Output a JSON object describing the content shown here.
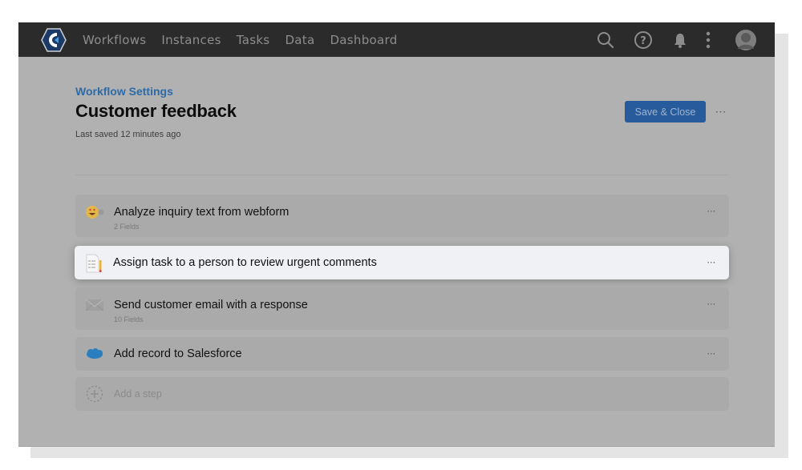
{
  "app": {
    "logo": "app-logo-hexagon",
    "nav": [
      "Workflows",
      "Instances",
      "Tasks",
      "Data",
      "Dashboard"
    ],
    "icons": [
      "search-icon",
      "help-icon",
      "bell-icon",
      "more-vertical-icon",
      "avatar"
    ]
  },
  "header": {
    "breadcrumb": "Workflow Settings",
    "title": "Customer feedback",
    "subtitle": "Last saved 12 minutes ago",
    "save_label": "Save & Close",
    "more_label": "⋯"
  },
  "steps": [
    {
      "title": "Analyze inquiry text from webform",
      "sub": "2 Fields",
      "icon": "emoji-sentiment-icon",
      "more": "⋯"
    },
    {
      "title": "Assign task to a person to review urgent comments",
      "sub": "",
      "icon": "form-task-icon",
      "more": "⋯",
      "active": true
    },
    {
      "title": "Send customer email with a response",
      "sub": "10 Fields",
      "icon": "envelope-icon",
      "more": "⋯"
    },
    {
      "title": "Add record to Salesforce",
      "sub": "",
      "icon": "salesforce-cloud-icon",
      "more": "⋯"
    }
  ],
  "add_step": {
    "label": "Add a step",
    "icon": "add-circle-icon"
  },
  "colors": {
    "accent": "#275b9b",
    "breadcrumb": "#2e6aa6",
    "topbar": "#2b2b2b",
    "overlay": "#b1b1b1",
    "active_card": "#f0f1f5"
  }
}
